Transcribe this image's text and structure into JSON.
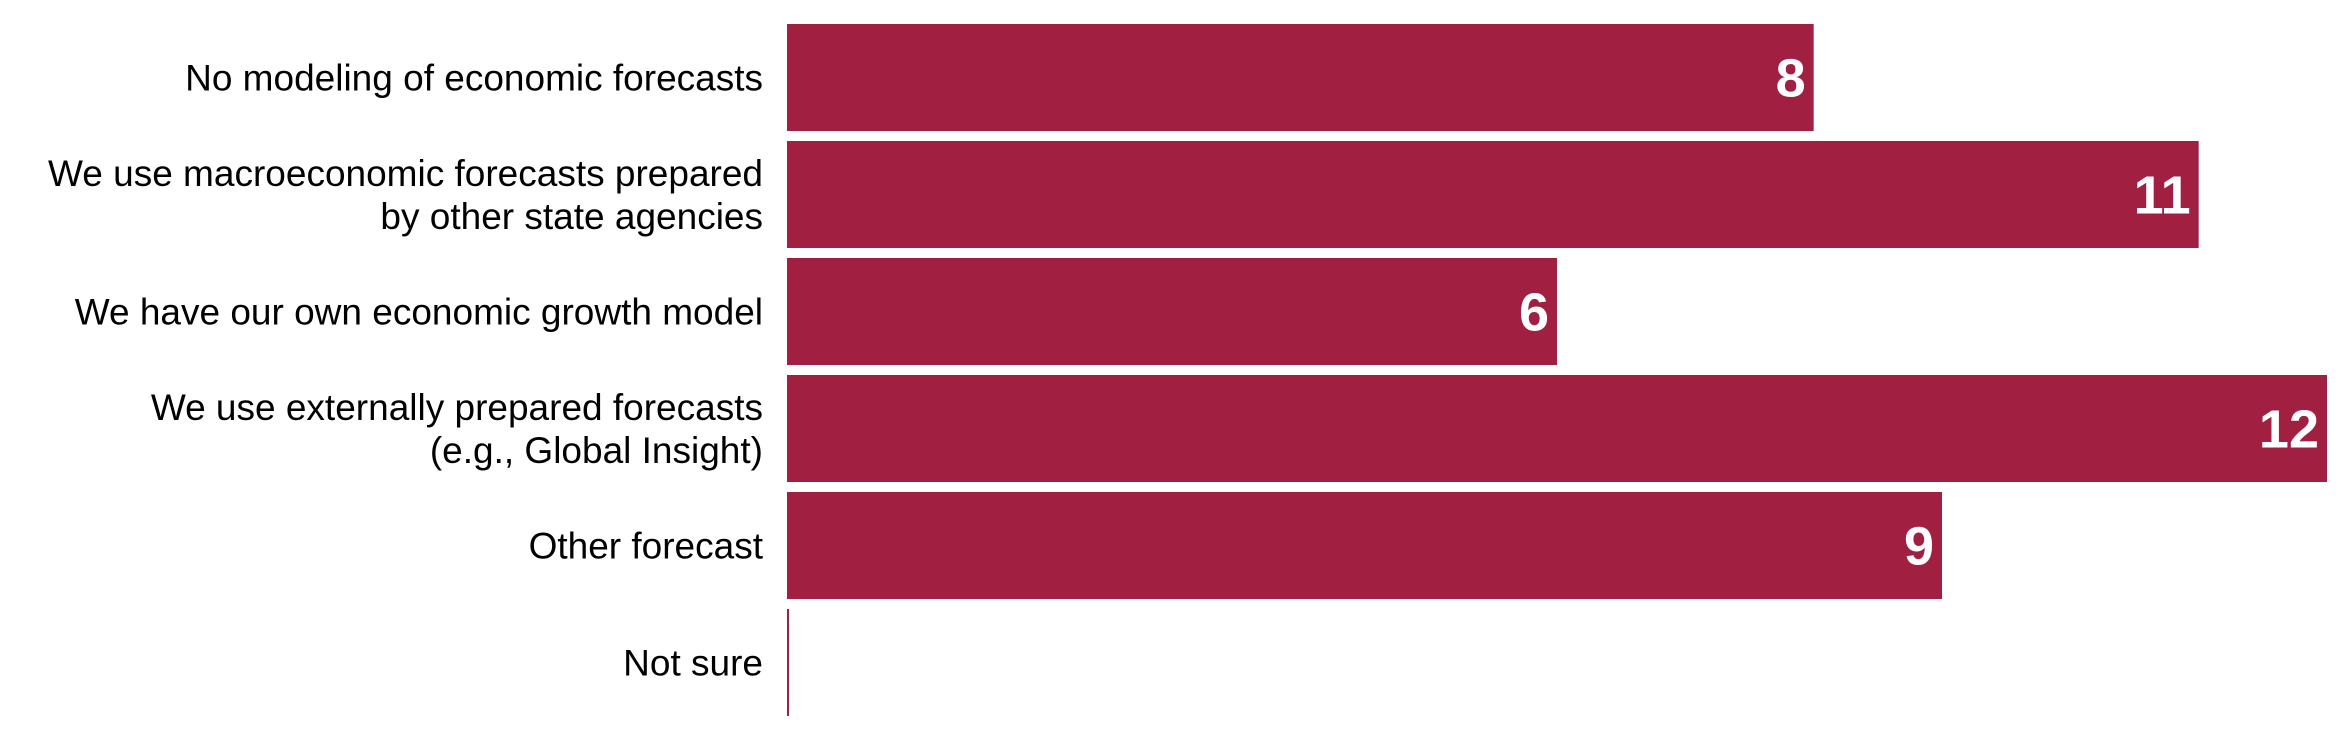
{
  "chart_data": {
    "type": "bar",
    "orientation": "horizontal",
    "categories": [
      [
        "No modeling of economic forecasts"
      ],
      [
        "We use macroeconomic forecasts prepared",
        "by other state agencies"
      ],
      [
        "We have our own economic growth model"
      ],
      [
        "We use externally prepared forecasts",
        "(e.g., Global Insight)"
      ],
      [
        "Other forecast"
      ],
      [
        "Not sure"
      ]
    ],
    "values": [
      8,
      11,
      6,
      12,
      9,
      0
    ],
    "value_labels": [
      "8",
      "11",
      "6",
      "12",
      "9",
      ""
    ],
    "xlim": [
      0,
      12
    ],
    "grid": false,
    "legend": "none",
    "bar_color": "#a12042"
  }
}
